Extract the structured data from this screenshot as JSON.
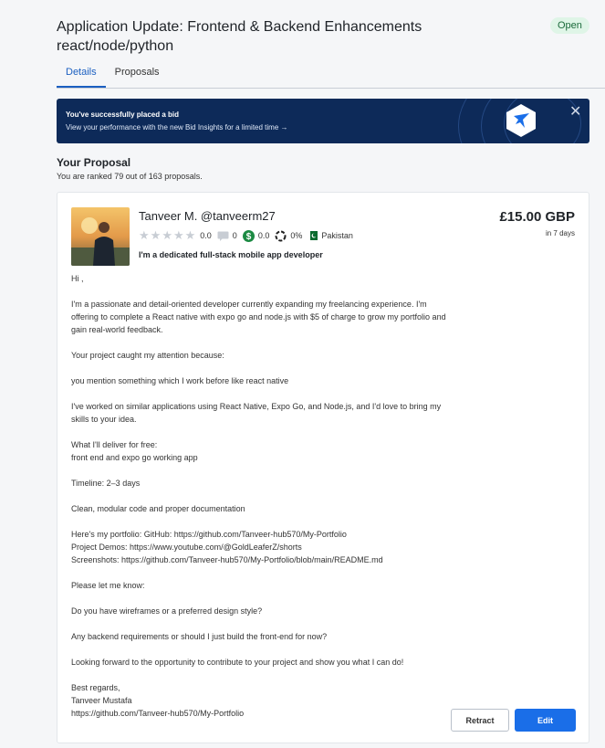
{
  "header": {
    "title_line1": "Application Update: Frontend & Backend Enhancements",
    "title_line2": "react/node/python",
    "status": "Open"
  },
  "tabs": [
    {
      "label": "Details",
      "active": true
    },
    {
      "label": "Proposals",
      "active": false
    }
  ],
  "banner": {
    "headline": "You've successfully placed a bid",
    "link": "View your performance with the new Bid Insights for a limited time →",
    "close_icon": "close-icon"
  },
  "proposal_section": {
    "title": "Your Proposal",
    "rank_text": "You are ranked 79 out of 163 proposals."
  },
  "proposal": {
    "name": "Tanveer M. @tanveerm27",
    "rating": "0.0",
    "reviews": "0",
    "earnings": "0.0",
    "completion": "0%",
    "country": "Pakistan",
    "headline": "I'm a dedicated full-stack mobile app developer",
    "price": "£15.00 GBP",
    "delivery": "in 7 days",
    "message": [
      "Hi ,",
      "I'm a passionate and detail-oriented developer currently expanding my freelancing experience. I'm offering to complete a React native with expo go and node.js with $5 of charge to grow my portfolio and gain real-world feedback.",
      "Your project caught my attention because:",
      "you mention something which I work before like react native",
      "I've worked on similar applications using React Native, Expo Go, and Node.js, and I'd love to bring my skills to your idea.",
      "What I'll deliver for free:\nfront end and expo go working app",
      "Timeline: 2–3 days",
      "Clean, modular code and proper documentation",
      "Here's my portfolio: GitHub: https://github.com/Tanveer-hub570/My-Portfolio\nProject Demos: https://www.youtube.com/@GoldLeaferZ/shorts\nScreenshots: https://github.com/Tanveer-hub570/My-Portfolio/blob/main/README.md",
      "Please let me know:",
      "Do you have wireframes or a preferred design style?",
      "Any backend requirements or should I just build the front-end for now?",
      "Looking forward to the opportunity to contribute to your project and show you what I can do!",
      "Best regards,\nTanveer Mustafa\nhttps://github.com/Tanveer-hub570/My-Portfolio"
    ]
  },
  "actions": {
    "retract": "Retract",
    "edit": "Edit"
  },
  "colors": {
    "accent": "#1a6ee8",
    "banner_bg": "#0d2a59",
    "status_bg": "#dff5e7",
    "earnings_icon": "#1c8a43"
  }
}
